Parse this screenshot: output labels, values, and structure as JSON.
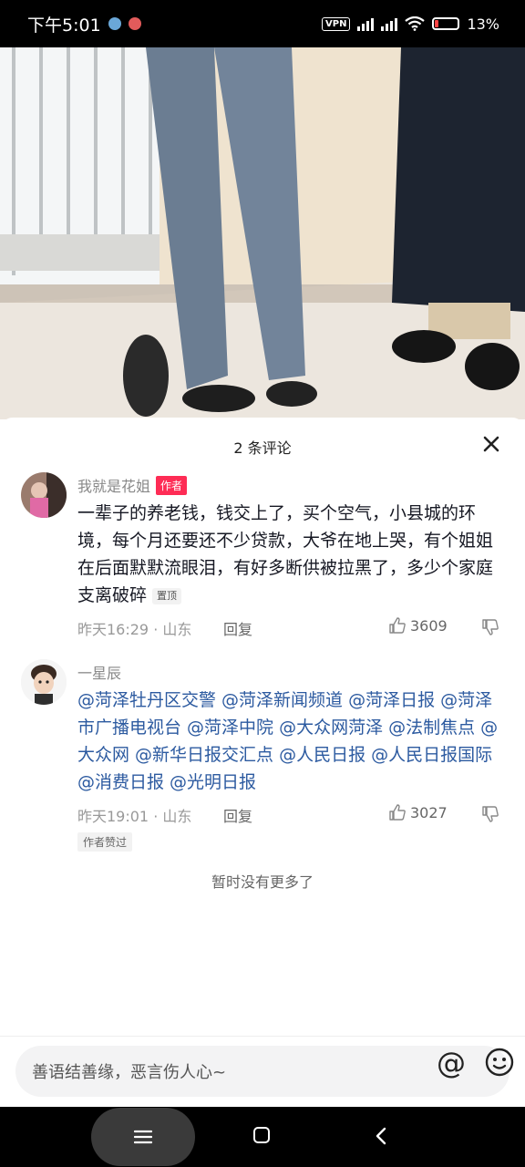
{
  "status_bar": {
    "time": "下午5:01",
    "vpn_label": "VPN",
    "battery_percent": "13%"
  },
  "comments_header": {
    "title": "2 条评论"
  },
  "comments": [
    {
      "username": "我就是花姐",
      "badge": "作者",
      "text": "一辈子的养老钱，钱交上了，买个空气，小县城的环境，每个月还要还不少贷款，大爷在地上哭，有个姐姐在后面默默流眼泪，有好多断供被拉黑了，多少个家庭支离破碎",
      "pin_label": "置顶",
      "time": "昨天16:29",
      "location": "山东",
      "reply_label": "回复",
      "likes": "3609"
    },
    {
      "username": "一星辰",
      "mentions": "@菏泽牡丹区交警 @菏泽新闻频道 @菏泽日报 @菏泽市广播电视台 @菏泽中院 @大众网菏泽 @法制焦点 @大众网 @新华日报交汇点 @人民日报 @人民日报国际 @消费日报 @光明日报",
      "time": "昨天19:01",
      "location": "山东",
      "reply_label": "回复",
      "likes": "3027",
      "liked_by_author": "作者赞过"
    }
  ],
  "no_more_text": "暂时没有更多了",
  "input": {
    "placeholder": "善语结善缘，恶言伤人心~"
  },
  "colors": {
    "accent": "#fe2c55",
    "mention": "#2c5aa0"
  }
}
